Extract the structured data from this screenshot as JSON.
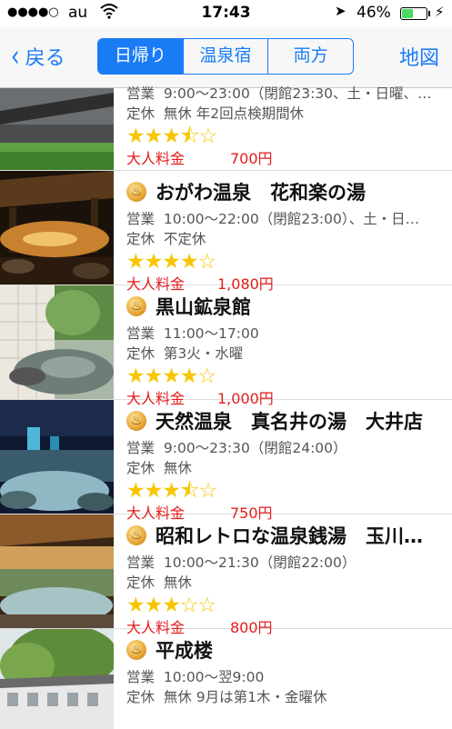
{
  "status_bar": {
    "carrier": "au",
    "time": "17:43",
    "battery": "46%",
    "signal_dots": "●●●●○"
  },
  "nav": {
    "back_label": "戻る",
    "segments": [
      "日帰り",
      "温泉宿",
      "両方"
    ],
    "active_segment": 0,
    "map_label": "地図"
  },
  "labels": {
    "hours_prefix": "営業",
    "closed_prefix": "定休",
    "price_prefix": "大人料金"
  },
  "facilities": [
    {
      "name": "",
      "hours": "9:00〜23:00（閉館23:30、土・日曜、…",
      "closed": "無休 年2回点検期間休",
      "rating": 3.5,
      "price": "700円"
    },
    {
      "name": "おがわ温泉　花和楽の湯",
      "hours": "10:00〜22:00（閉館23:00）、土・日…",
      "closed": "不定休",
      "rating": 4,
      "price": "1,080円"
    },
    {
      "name": "黒山鉱泉館",
      "hours": "11:00〜17:00",
      "closed": "第3火・水曜",
      "rating": 4,
      "price": "1,000円"
    },
    {
      "name": "天然温泉　真名井の湯　大井店",
      "hours": "9:00〜23:30（閉館24:00）",
      "closed": "無休",
      "rating": 3.5,
      "price": "750円"
    },
    {
      "name": "昭和レトロな温泉銭湯　玉川…",
      "hours": "10:00〜21:30（閉館22:00）",
      "closed": "無休",
      "rating": 3,
      "price": "800円"
    },
    {
      "name": "平成楼",
      "hours": "10:00〜翌9:00",
      "closed": "無休 9月は第1木・金曜休",
      "rating": null,
      "price": ""
    }
  ]
}
